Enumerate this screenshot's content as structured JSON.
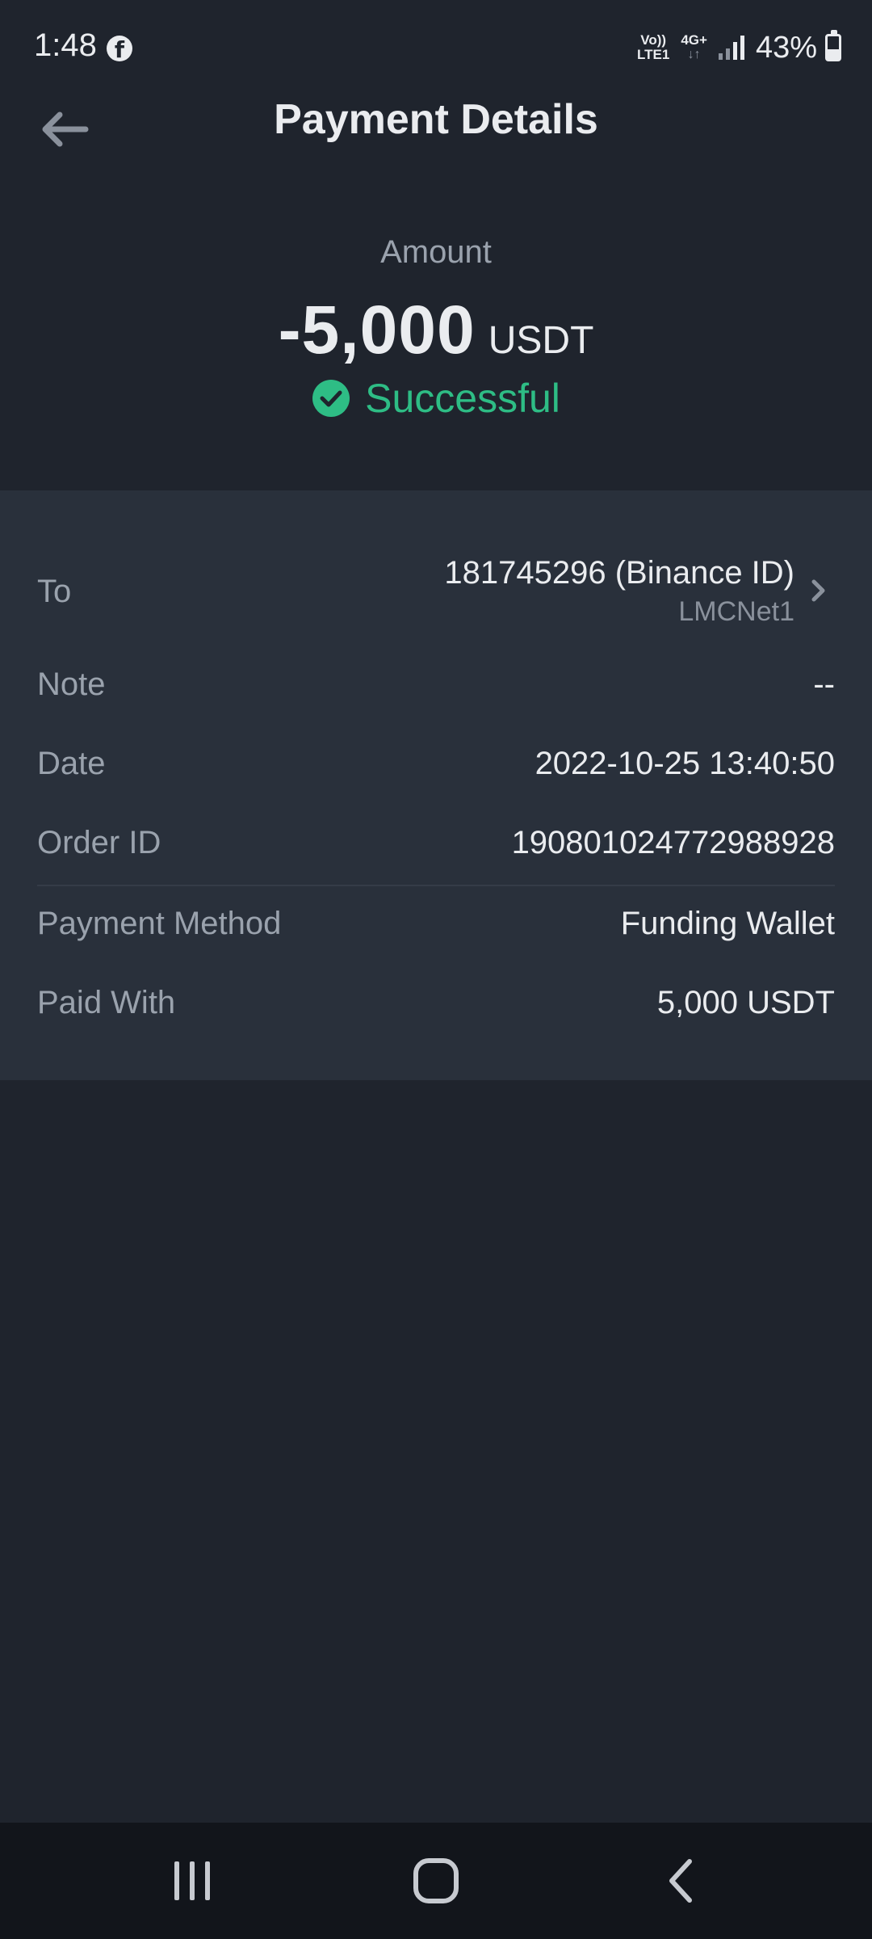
{
  "status_bar": {
    "time": "1:48",
    "app_icon": "facebook-icon",
    "volte_line1": "Vo))",
    "volte_line2": "LTE1",
    "network_type": "4G+",
    "network_arrows": "↓↑",
    "battery_percent": "43%",
    "battery_level": 0.43
  },
  "header": {
    "title": "Payment Details",
    "back_icon": "arrow-left-icon"
  },
  "amount": {
    "label": "Amount",
    "value": "-5,000",
    "currency": "USDT",
    "status": "Successful",
    "status_color": "#2ebd85"
  },
  "details": {
    "to": {
      "label": "To",
      "id": "181745296 (Binance ID)",
      "name": "LMCNet1"
    },
    "note": {
      "label": "Note",
      "value": "--"
    },
    "date": {
      "label": "Date",
      "value": "2022-10-25 13:40:50"
    },
    "order_id": {
      "label": "Order ID",
      "value": "190801024772988928"
    },
    "payment_method": {
      "label": "Payment Method",
      "value": "Funding Wallet"
    },
    "paid_with": {
      "label": "Paid With",
      "value": "5,000 USDT"
    }
  },
  "nav_bar": {
    "recents_icon": "recent-apps-icon",
    "home_icon": "home-icon",
    "back_icon": "back-icon"
  },
  "colors": {
    "background": "#1f242d",
    "card": "#29303b",
    "accent_success": "#2ebd85"
  }
}
